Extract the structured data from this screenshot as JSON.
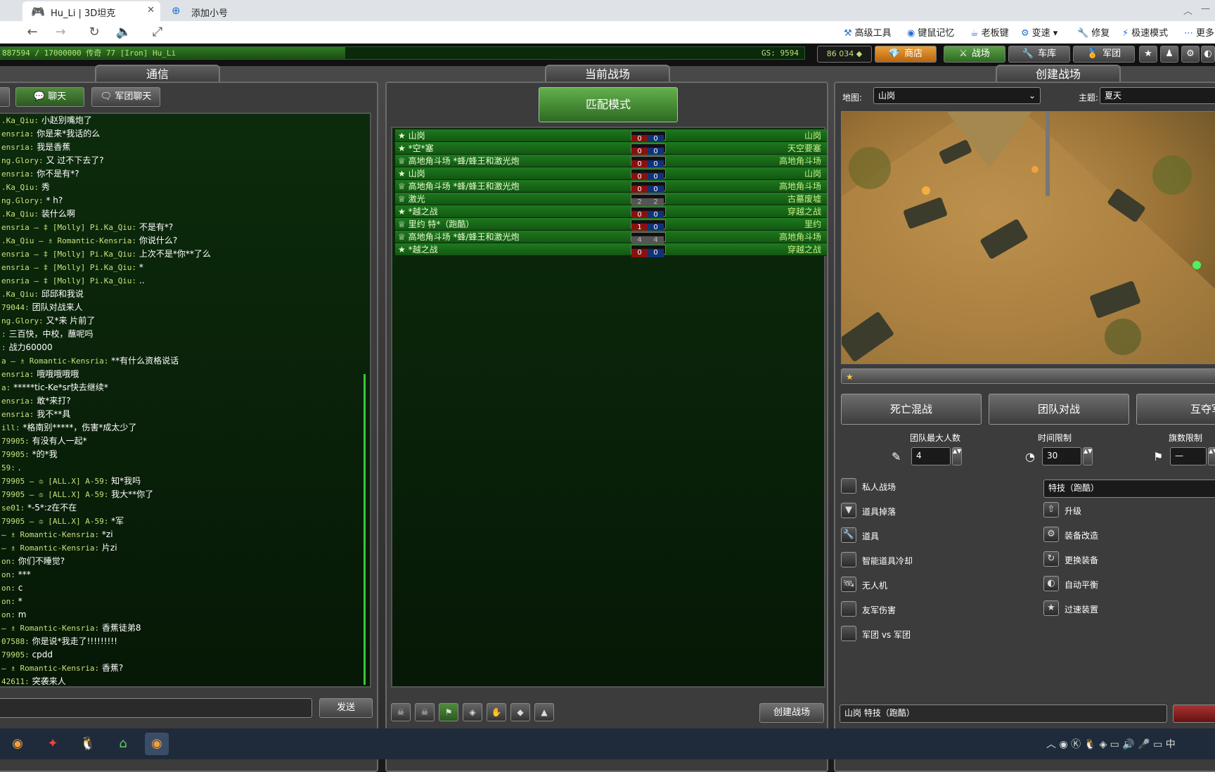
{
  "browser": {
    "tabs": [
      {
        "label": "Hu_Li | 3D坦克"
      },
      {
        "label": "添加小号"
      }
    ],
    "tools": [
      "高级工具",
      "键鼠记忆",
      "老板键",
      "变速",
      "修复",
      "极速模式",
      "更多"
    ]
  },
  "hud": {
    "xp_text": "887594 / 17000000   传奇 77 [Iron] Hu_Li",
    "gs": "GS: 9594",
    "crystals": "86 034",
    "buttons": {
      "shop": "商店",
      "battle": "战场",
      "garage": "车库",
      "clan": "军团"
    }
  },
  "chat": {
    "title": "通信",
    "tab_chat": "聊天",
    "tab_clan": "军团聊天",
    "send": "发送",
    "lines": [
      {
        "name": ".Ka_Qiu:",
        "text": "小赵别嘴炮了"
      },
      {
        "name": "ensria:",
        "text": "你是来*我话的么"
      },
      {
        "name": "ensria:",
        "text": "我是香蕉"
      },
      {
        "name": "ng.Glory:",
        "text": "又 过不下去了?"
      },
      {
        "name": "ensria:",
        "text": "你不是有*?"
      },
      {
        "name": ".Ka_Qiu:",
        "text": "秀"
      },
      {
        "name": "ng.Glory:",
        "text": "* h?"
      },
      {
        "name": ".Ka_Qiu:",
        "text": "装什么啊"
      },
      {
        "name": "ensria — ‡ [Molly] Pi.Ka_Qiu:",
        "text": "不是有*?"
      },
      {
        "name": ".Ka_Qiu — ♗ Romantic-Kensria:",
        "text": "你说什么?"
      },
      {
        "name": "ensria — ‡ [Molly] Pi.Ka_Qiu:",
        "text": "上次不是*你**了么"
      },
      {
        "name": "ensria — ‡ [Molly] Pi.Ka_Qiu:",
        "text": "*"
      },
      {
        "name": "ensria — ‡ [Molly] Pi.Ka_Qiu:",
        "text": ".."
      },
      {
        "name": ".Ka_Qiu:",
        "text": "邱邱和我说"
      },
      {
        "name": "79044:",
        "text": "团队对战来人"
      },
      {
        "name": "ng.Glory:",
        "text": "又*来 片前了"
      },
      {
        "name": ":",
        "text": "三百快，中校，蘸呢吗"
      },
      {
        "name": ":",
        "text": "战力60000"
      },
      {
        "name": "a — ♗ Romantic-Kensria:",
        "text": "**有什么资格说话"
      },
      {
        "name": "ensria:",
        "text": "哦哦哦哦哦"
      },
      {
        "name": "a:",
        "text": "*****tic-Ke*sr快去继续*"
      },
      {
        "name": "ensria:",
        "text": "敢*来打?"
      },
      {
        "name": "ensria:",
        "text": "我不**具"
      },
      {
        "name": "ill:",
        "text": "*格南别*****，伤害*成太少了"
      },
      {
        "name": "79905:",
        "text": "有没有人一起*"
      },
      {
        "name": "79905:",
        "text": "*的*我"
      },
      {
        "name": "59:",
        "text": "."
      },
      {
        "name": "79905 — ♔ [ALL.X] A-59:",
        "text": "知*我吗"
      },
      {
        "name": "79905 — ♔ [ALL.X] A-59:",
        "text": "我大**你了"
      },
      {
        "name": "se01:",
        "text": "*-5*:z在不在"
      },
      {
        "name": "79905 — ♔ [ALL.X] A-59:",
        "text": "*军"
      },
      {
        "name": "— ♗ Romantic-Kensria:",
        "text": "*zi"
      },
      {
        "name": "— ♗ Romantic-Kensria:",
        "text": "片zi"
      },
      {
        "name": "on:",
        "text": "你们不睡觉?"
      },
      {
        "name": "on:",
        "text": "***"
      },
      {
        "name": "on:",
        "text": "c"
      },
      {
        "name": "on:",
        "text": "*"
      },
      {
        "name": "on:",
        "text": "m"
      },
      {
        "name": "— ♗ Romantic-Kensria:",
        "text": "香蕉徒弟8"
      },
      {
        "name": "07588:",
        "text": "你是说*我走了!!!!!!!!!"
      },
      {
        "name": "79905:",
        "text": "cpdd"
      },
      {
        "name": "— ♗ Romantic-Kensria:",
        "text": "香蕉?"
      },
      {
        "name": "42611:",
        "text": "突袭来人"
      }
    ]
  },
  "battles": {
    "title": "当前战场",
    "match_mode": "匹配模式",
    "create": "创建战场",
    "rows": [
      {
        "name": "山岗",
        "red": "0",
        "blue": "0",
        "map": "山岗",
        "icon": "★",
        "grey": false
      },
      {
        "name": "*空*塞",
        "red": "0",
        "blue": "0",
        "map": "天空要塞",
        "icon": "★",
        "grey": false
      },
      {
        "name": "高地角斗场 *蜂/蜂王和激光炮",
        "red": "0",
        "blue": "0",
        "map": "高地角斗场",
        "icon": "♕",
        "grey": false
      },
      {
        "name": "山岗",
        "red": "0",
        "blue": "0",
        "map": "山岗",
        "icon": "★",
        "grey": false
      },
      {
        "name": "高地角斗场 *蜂/蜂王和激光炮",
        "red": "0",
        "blue": "0",
        "map": "高地角斗场",
        "icon": "♕",
        "grey": false
      },
      {
        "name": "激光",
        "red": "2",
        "blue": "2",
        "map": "古墓废墟",
        "icon": "♕",
        "grey": true
      },
      {
        "name": "*越之战",
        "red": "0",
        "blue": "0",
        "map": "穿越之战",
        "icon": "★",
        "grey": false
      },
      {
        "name": "里约 特*（跑酷）",
        "red": "1",
        "blue": "0",
        "map": "里约",
        "icon": "♕",
        "grey": false
      },
      {
        "name": "高地角斗场 *蜂/蜂王和激光炮",
        "red": "4",
        "blue": "4",
        "map": "高地角斗场",
        "icon": "♕",
        "grey": true
      },
      {
        "name": "*越之战",
        "red": "0",
        "blue": "0",
        "map": "穿越之战",
        "icon": "★",
        "grey": false
      }
    ]
  },
  "create": {
    "title": "创建战场",
    "map_label": "地图:",
    "map_value": "山岗",
    "theme_label": "主题:",
    "theme_value": "夏天",
    "modes": [
      "死亡混战",
      "团队对战",
      "互夺军旗"
    ],
    "max_players_label": "团队最大人数",
    "max_players": "4",
    "time_label": "时间限制",
    "time": "30",
    "flag_label": "旗数限制",
    "flag": "—",
    "options_left": [
      "私人战场",
      "道具掉落",
      "道具",
      "智能道具冷却",
      "无人机",
      "友军伤害",
      "军团 vs 军团"
    ],
    "special_select": "特技（跑酷）",
    "options_right": [
      "升级",
      "装备改造",
      "更换装备",
      "自动平衡",
      "过速装置"
    ],
    "name_field": "山岗 特技（跑酷）"
  },
  "colors": {
    "accent_green": "#3f9a2a",
    "panel": "#3c3c3c",
    "list_green": "#1e7a1e"
  }
}
